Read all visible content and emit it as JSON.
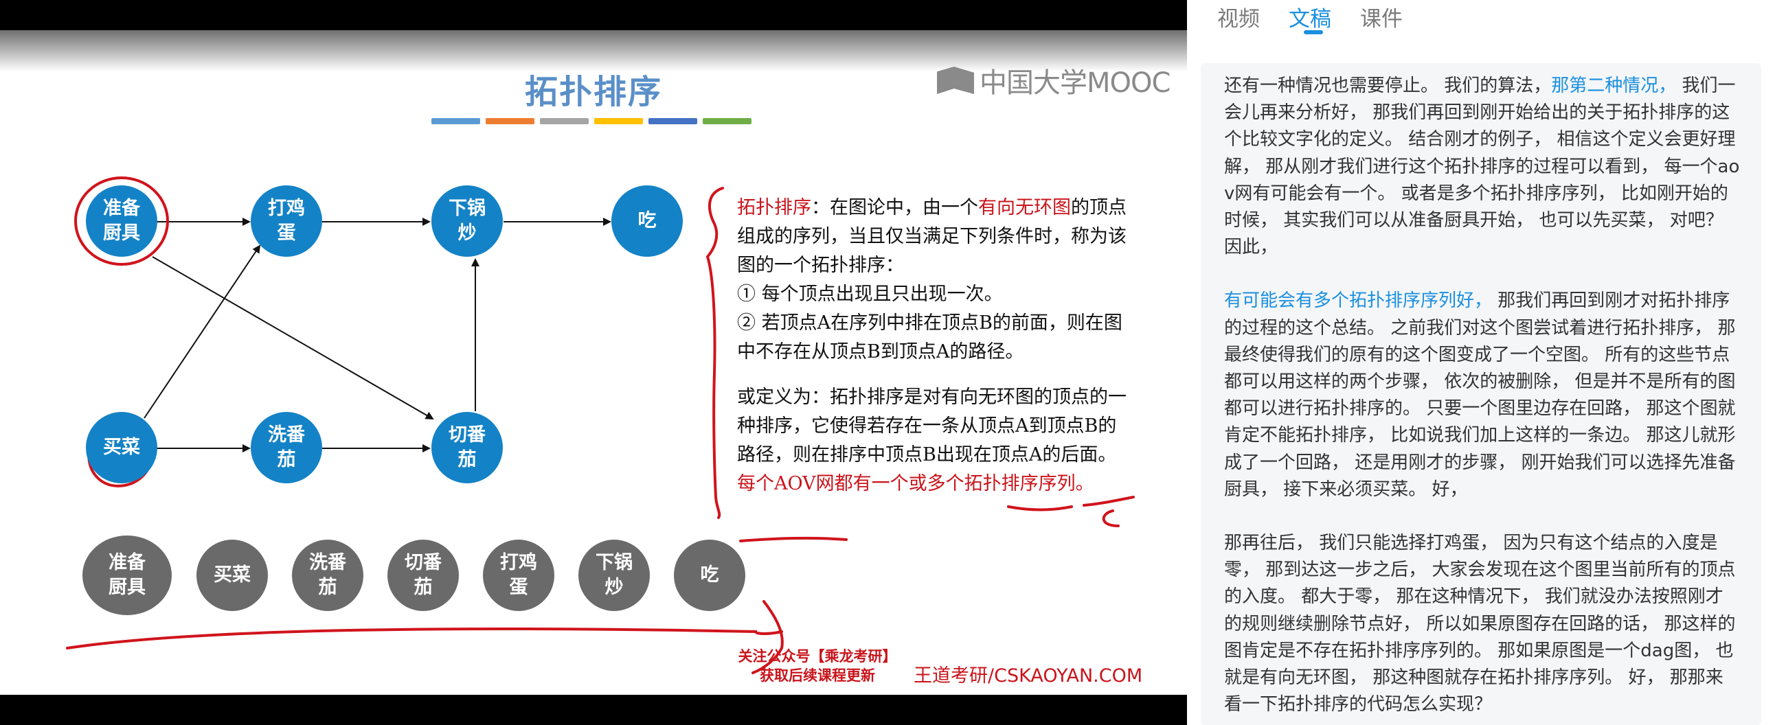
{
  "slide": {
    "title": "拓扑排序",
    "title_bar_colors": [
      "#5b9bd5",
      "#ed7d31",
      "#a5a5a5",
      "#ffc000",
      "#4472c4",
      "#70ad47"
    ],
    "logo_text": "中国大学MOOC",
    "nodes": {
      "n1": "准备厨具",
      "n2": "打鸡蛋",
      "n3": "下锅炒",
      "n4": "吃",
      "n5": "买菜",
      "n6": "洗番茄",
      "n7": "切番茄"
    },
    "sequence": [
      "准备厨具",
      "买菜",
      "洗番茄",
      "切番茄",
      "打鸡蛋",
      "下锅炒",
      "吃"
    ],
    "definition": {
      "term": "拓扑排序",
      "p1_a": "：在图论中，由一个",
      "p1_red": "有向无环图",
      "p1_b": "的顶点组成的序列，当且仅当满足下列条件时，称为该图的一个拓扑排序：",
      "item1": "① 每个顶点出现且只出现一次。",
      "item2": "② 若顶点A在序列中排在顶点B的前面，则在图中不存在从顶点B到顶点A的路径。",
      "p2": "或定义为：拓扑排序是对有向无环图的顶点的一种排序，它使得若存在一条从顶点A到顶点B的路径，则在排序中顶点B出现在顶点A的后面。",
      "p2_red": "每个AOV网都有一个或多个拓扑排序序列。"
    },
    "footer_left_1": "关注公众号【乘龙考研】",
    "footer_left_2": "获取后续课程更新",
    "footer_right": "王道考研/CSKAOYAN.COM",
    "accent_color": "#1482c6",
    "annotation_color": "#c9141b"
  },
  "panel": {
    "tabs": [
      "视频",
      "文稿",
      "课件"
    ],
    "active_tab": "文稿",
    "paragraphs": [
      {
        "pre": "还有一种情况也需要停止。 我们的算法，",
        "hl": "那第二种情况，",
        "post": "我们一会儿再来分析好， 那我们再回到刚开始给出的关于拓扑排序的这个比较文字化的定义。 结合刚才的例子， 相信这个定义会更好理解， 那从刚才我们进行这个拓扑排序的过程可以看到， 每一个ao v网有可能会有一个。 或者是多个拓扑排序序列， 比如刚开始的时候， 其实我们可以从准备厨具开始， 也可以先买菜， 对吧？ 因此，"
      },
      {
        "pre": "",
        "hl": "有可能会有多个拓扑排序序列好，",
        "post": "那我们再回到刚才对拓扑排序的过程的这个总结。 之前我们对这个图尝试着进行拓扑排序， 那最终使得我们的原有的这个图变成了一个空图。 所有的这些节点都可以用这样的两个步骤， 依次的被删除， 但是并不是所有的图都可以进行拓扑排序的。 只要一个图里边存在回路， 那这个图就肯定不能拓扑排序， 比如说我们加上这样的一条边。 那这儿就形成了一个回路， 还是用刚才的步骤， 刚开始我们可以选择先准备厨具， 接下来必须买菜。 好，"
      },
      {
        "pre": "那再往后， 我们只能选择打鸡蛋， 因为只有这个结点的入度是零， 那到达这一步之后， 大家会发现在这个图里当前所有的顶点的入度。 都大于零， 那在这种情况下， 我们就没办法按照刚才的规则继续删除节点好， 所以如果原图存在回路的话， 那这样的图肯定是不存在拓扑排序序列的。 那如果原图是一个dag图， 也就是有向无环图， 那这种图就存在拓扑排序序列。 好， 那那来看一下拓扑排序的代码怎么实现？",
        "hl": "",
        "post": ""
      }
    ]
  }
}
